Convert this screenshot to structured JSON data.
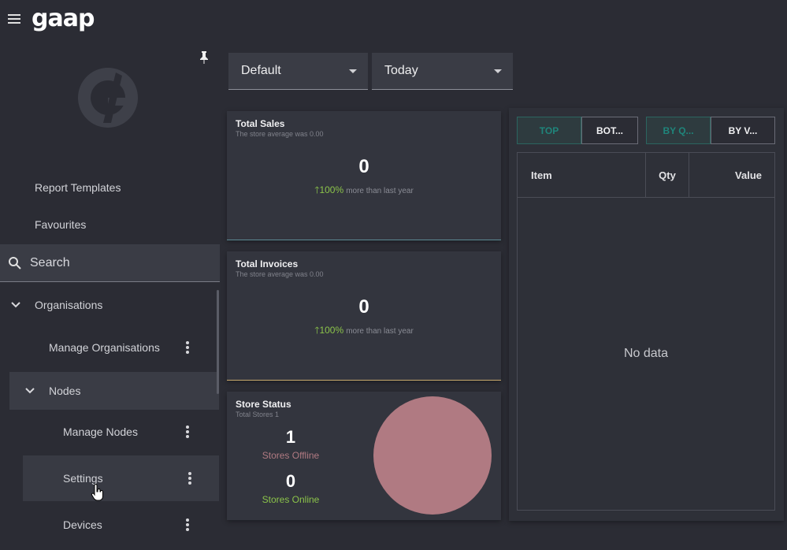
{
  "app": {
    "logo": "gaap"
  },
  "sidebar": {
    "report_templates": "Report Templates",
    "favourites": "Favourites",
    "search_placeholder": "Search",
    "organisations": "Organisations",
    "manage_organisations": "Manage Organisations",
    "nodes": "Nodes",
    "manage_nodes": "Manage Nodes",
    "settings": "Settings",
    "devices": "Devices"
  },
  "filters": {
    "profile": "Default",
    "period": "Today"
  },
  "total_sales": {
    "title": "Total Sales",
    "subtitle": "The store average was 0.00",
    "value": "0",
    "change": "100%",
    "change_suffix": "more than last year"
  },
  "total_invoices": {
    "title": "Total Invoices",
    "subtitle": "The store average was 0.00",
    "value": "0",
    "change": "100%",
    "change_suffix": "more than last year"
  },
  "store_status": {
    "title": "Store Status",
    "subtitle": "Total Stores 1",
    "offline_count": "1",
    "offline_label": "Stores Offline",
    "online_count": "0",
    "online_label": "Stores Online",
    "offline_color": "#b07a82",
    "online_color": "#8bc34a"
  },
  "top_items": {
    "top_label": "TOP",
    "bottom_label": "BOT...",
    "by_qty_label": "BY Q...",
    "by_value_label": "BY V...",
    "columns": [
      "Item",
      "Qty",
      "Value"
    ],
    "empty_text": "No data"
  },
  "colors": {
    "accent": "#1f857b",
    "background": "#2b2c34",
    "card": "#33353e"
  }
}
